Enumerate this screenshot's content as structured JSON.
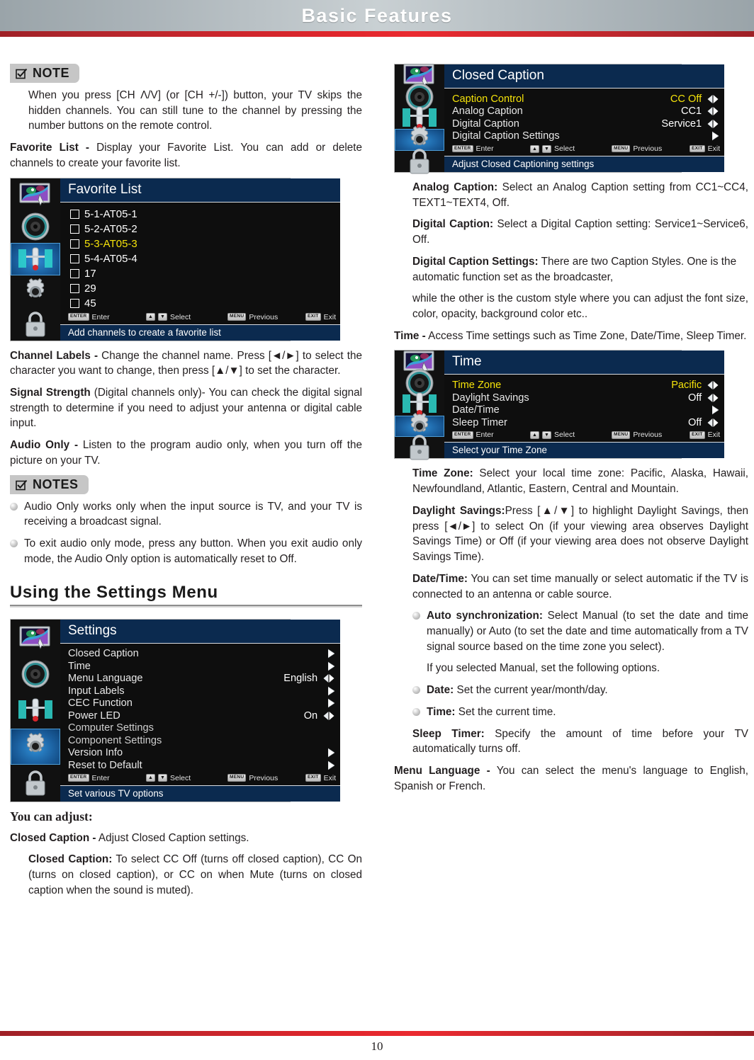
{
  "header": {
    "title": "Basic Features"
  },
  "footer": {
    "page_number": "10"
  },
  "left": {
    "note_badge": "NOTE",
    "note_text": "When you press [CH Λ/V] (or [CH +/-]) button, your TV skips the hidden channels. You can still tune to the channel by pressing the number buttons on the remote control.",
    "favorite_list_label": "Favorite List -",
    "favorite_list_text": " Display your Favorite List. You can add or delete channels to create your favorite list.",
    "channel_labels_label": "Channel Labels -",
    "channel_labels_text": " Change the channel name. Press [◄/►] to select the character you want to change, then press [▲/▼] to set the character.",
    "signal_strength_label": "Signal Strength",
    "signal_strength_text": " (Digital channels only)- You can check the digital signal strength to determine if you need to adjust your antenna or digital cable input.",
    "audio_only_label": "Audio Only -",
    "audio_only_text": " Listen to the program audio only, when you turn off the picture on your TV.",
    "notes_badge": "NOTES",
    "notes": [
      "Audio Only works only when the input source is TV, and your TV is receiving a broadcast signal.",
      "To exit audio only mode, press any button. When you exit audio only mode, the Audio Only option is automatically reset to Off."
    ],
    "section_heading": "Using the Settings Menu",
    "you_can_adjust": "You can adjust:",
    "closed_caption_label": "Closed Caption -",
    "closed_caption_text": " Adjust Closed Caption settings.",
    "closed_caption_sub_label": "Closed Caption:",
    "closed_caption_sub_text": " To select CC Off (turns off closed caption), CC On (turns on closed caption), or CC on when Mute (turns on closed caption when the sound is muted)."
  },
  "right": {
    "analog_caption_label": "Analog Caption:",
    "analog_caption_text": " Select an Analog Caption setting from CC1~CC4, TEXT1~TEXT4, Off.",
    "digital_caption_label": "Digital Caption:",
    "digital_caption_text": " Select a Digital Caption setting: Service1~Service6, Off.",
    "digital_caption_settings_label": "Digital Caption Settings:",
    "digital_caption_settings_text": " There are two Caption Styles. One is the automatic function set as the broadcaster,",
    "digital_caption_settings_text2": "while the other is the custom style where you can adjust the font size, color, opacity, background color etc..",
    "time_label": "Time -",
    "time_text": " Access Time settings such as Time Zone, Date/Time, Sleep Timer.",
    "time_zone_label": "Time Zone:",
    "time_zone_text": " Select your local time zone: Pacific, Alaska, Hawaii, Newfoundland, Atlantic, Eastern, Central and Mountain.",
    "daylight_savings_label": "Daylight Savings:",
    "daylight_savings_text": "Press [▲/▼] to highlight Daylight Savings, then press [◄/►] to select On (if your viewing area observes Daylight Savings Time) or Off (if your viewing area does not observe Daylight Savings Time).",
    "date_time_label": "Date/Time:",
    "date_time_text": " You can set time manually or select automatic if the TV is connected to an antenna or cable source.",
    "auto_sync_label": "Auto synchronization:",
    "auto_sync_text": " Select Manual (to set the date and time manually) or Auto (to set the date and time automatically from a TV signal source based on the time zone you select).",
    "if_manual_text": "If you selected Manual, set the following options.",
    "date_label": "Date:",
    "date_text": " Set the current year/month/day.",
    "time_item_label": "Time:",
    "time_item_text": " Set the current time.",
    "sleep_timer_label": "Sleep Timer:",
    "sleep_timer_text": " Specify the amount of time before your TV automatically turns off.",
    "menu_language_label": "Menu Language -",
    "menu_language_text": " You can select the menu's language to English, Spanish or French."
  },
  "osd_keys": {
    "enter_cap": "ENTER",
    "enter": "Enter",
    "select": "Select",
    "menu_cap": "MENU",
    "previous": "Previous",
    "exit_cap": "EXIT",
    "exit": "Exit"
  },
  "osd_favorite": {
    "title": "Favorite List",
    "active_rail_index": 2,
    "items": [
      {
        "label": "5-1-AT05-1",
        "selected": false
      },
      {
        "label": "5-2-AT05-2",
        "selected": false
      },
      {
        "label": "5-3-AT05-3",
        "selected": true
      },
      {
        "label": "5-4-AT05-4",
        "selected": false
      },
      {
        "label": "17",
        "selected": false
      },
      {
        "label": "29",
        "selected": false
      },
      {
        "label": "45",
        "selected": false
      }
    ],
    "help": "Add channels to create a favorite list"
  },
  "osd_settings": {
    "title": "Settings",
    "active_rail_index": 3,
    "rows": [
      {
        "label": "Closed Caption",
        "value": "",
        "arrow": "right",
        "selected": false,
        "dim": false
      },
      {
        "label": "Time",
        "value": "",
        "arrow": "right",
        "selected": false,
        "dim": false
      },
      {
        "label": "Menu Language",
        "value": "English",
        "arrow": "leftright",
        "selected": false,
        "dim": false
      },
      {
        "label": "Input Labels",
        "value": "",
        "arrow": "right",
        "selected": false,
        "dim": false
      },
      {
        "label": "CEC Function",
        "value": "",
        "arrow": "right",
        "selected": false,
        "dim": false
      },
      {
        "label": "Power LED",
        "value": "On",
        "arrow": "leftright",
        "selected": false,
        "dim": false
      },
      {
        "label": "Computer Settings",
        "value": "",
        "arrow": "none",
        "selected": false,
        "dim": true
      },
      {
        "label": "Component Settings",
        "value": "",
        "arrow": "none",
        "selected": false,
        "dim": true
      },
      {
        "label": "Version Info",
        "value": "",
        "arrow": "right",
        "selected": false,
        "dim": false
      },
      {
        "label": "Reset to Default",
        "value": "",
        "arrow": "right",
        "selected": false,
        "dim": false
      }
    ],
    "help": "Set various TV options"
  },
  "osd_closed_caption": {
    "title": "Closed Caption",
    "active_rail_index": 3,
    "rows": [
      {
        "label": "Caption Control",
        "value": "CC Off",
        "arrow": "leftright",
        "selected": true,
        "dim": false
      },
      {
        "label": "Analog Caption",
        "value": "CC1",
        "arrow": "leftright",
        "selected": false,
        "dim": false
      },
      {
        "label": "Digital Caption",
        "value": "Service1",
        "arrow": "leftright",
        "selected": false,
        "dim": false
      },
      {
        "label": "Digital Caption Settings",
        "value": "",
        "arrow": "right",
        "selected": false,
        "dim": false
      }
    ],
    "help": "Adjust Closed Captioning settings"
  },
  "osd_time": {
    "title": "Time",
    "active_rail_index": 3,
    "rows": [
      {
        "label": "Time Zone",
        "value": "Pacific",
        "arrow": "leftright",
        "selected": true,
        "dim": false
      },
      {
        "label": "Daylight Savings",
        "value": "Off",
        "arrow": "leftright",
        "selected": false,
        "dim": false
      },
      {
        "label": "Date/Time",
        "value": "",
        "arrow": "right",
        "selected": false,
        "dim": false
      },
      {
        "label": "Sleep Timer",
        "value": "Off",
        "arrow": "leftright",
        "selected": false,
        "dim": false
      }
    ],
    "help": "Select your Time Zone"
  }
}
